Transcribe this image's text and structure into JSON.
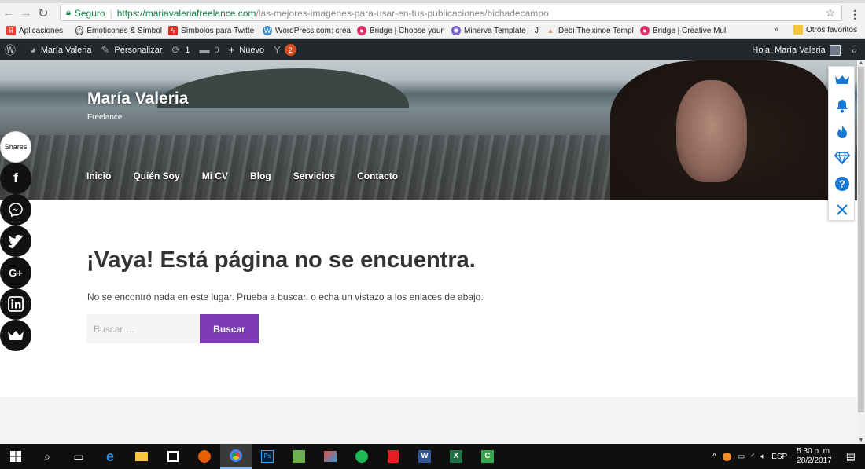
{
  "browser": {
    "secure_label": "Seguro",
    "url_host": "https://mariavaleriafreelance.com",
    "url_path": "/las-mejores-imagenes-para-usar-en-tus-publicaciones/bichadecampo",
    "bookmarks": [
      {
        "label": "Aplicaciones",
        "icon": "apps-grid-icon",
        "color": "#e94235"
      },
      {
        "label": "Emoticones & Símbol",
        "icon": "clock-icon",
        "color": "#333333"
      },
      {
        "label": "Símbolos para Twitte",
        "icon": "bolt-icon",
        "color": "#d93025"
      },
      {
        "label": "WordPress.com: crea",
        "icon": "wordpress-icon",
        "color": "#3b8eca"
      },
      {
        "label": "Bridge | Choose your",
        "icon": "bridge-icon",
        "color": "#e5306d"
      },
      {
        "label": "Minerva Template – J",
        "icon": "minerva-icon",
        "color": "#7b5ec6"
      },
      {
        "label": "Debi Thelxinoe Templ",
        "icon": "debi-icon",
        "color": "#c9a060"
      },
      {
        "label": "Bridge | Creative Mul",
        "icon": "bridge-icon",
        "color": "#e5306d"
      }
    ],
    "more_label": "»",
    "other_bookmarks": "Otros favoritos"
  },
  "adminbar": {
    "site_name": "María Valeria",
    "customize": "Personalizar",
    "updates_count": "1",
    "comments_count": "0",
    "new_label": "Nuevo",
    "yoast_count": "2",
    "greeting": "Hola, María Valeria"
  },
  "header": {
    "site_title": "María Valeria",
    "site_description": "Freelance",
    "nav": [
      "Inicio",
      "Quién Soy",
      "Mi CV",
      "Blog",
      "Servicios",
      "Contacto"
    ]
  },
  "content": {
    "error_title": "¡Vaya! Está página no se encuentra.",
    "error_text": "No se encontró nada en este lugar. Prueba a buscar, o echa un vistazo a los enlaces de abajo.",
    "search_placeholder": "Buscar …",
    "search_button": "Buscar"
  },
  "sharebar": {
    "label": "Shares",
    "buttons": [
      "facebook-icon",
      "messenger-icon",
      "twitter-icon",
      "google-plus-icon",
      "linkedin-icon",
      "crown-icon"
    ]
  },
  "floatpanel": {
    "buttons": [
      "crown-icon",
      "bell-icon",
      "flame-icon",
      "diamond-icon",
      "help-icon",
      "close-icon"
    ],
    "accent": "#1877d2"
  },
  "taskbar": {
    "language": "ESP",
    "time": "5:30 p. m.",
    "date": "28/2/2017"
  },
  "colors": {
    "button_purple": "#7c3bb5",
    "adminbar_bg": "#23282d"
  }
}
